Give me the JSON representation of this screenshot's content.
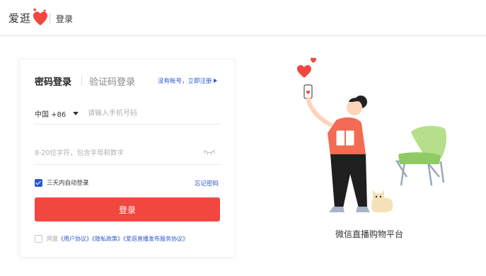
{
  "header": {
    "logo_text": "爱逛",
    "title": "登录"
  },
  "login": {
    "tab_password": "密码登录",
    "tab_code": "验证码登录",
    "register_link": "没有帐号，立即注册",
    "country_code": "中国 +86",
    "phone_placeholder": "请输入手机号码",
    "password_placeholder": "8-20位字符，包含字母和数字",
    "remember_label": "三天内自动登录",
    "remember_checked": true,
    "forgot_link": "忘记密码",
    "login_button": "登录",
    "agree_prefix": "同意",
    "agreement_user": "《用户协议》",
    "agreement_privacy": "《隐私政策》",
    "agreement_service": "《爱逛直播发布服务协议》",
    "agree_checked": false
  },
  "promo": {
    "tagline": "微信直播购物平台"
  },
  "colors": {
    "brand_red": "#f2473f",
    "link_blue": "#2a57c9"
  },
  "icons": {
    "logo": "heart-icon",
    "dropdown": "caret-down-icon",
    "password_toggle": "eye-closed-icon",
    "register_arrow": "play-arrow-icon"
  }
}
